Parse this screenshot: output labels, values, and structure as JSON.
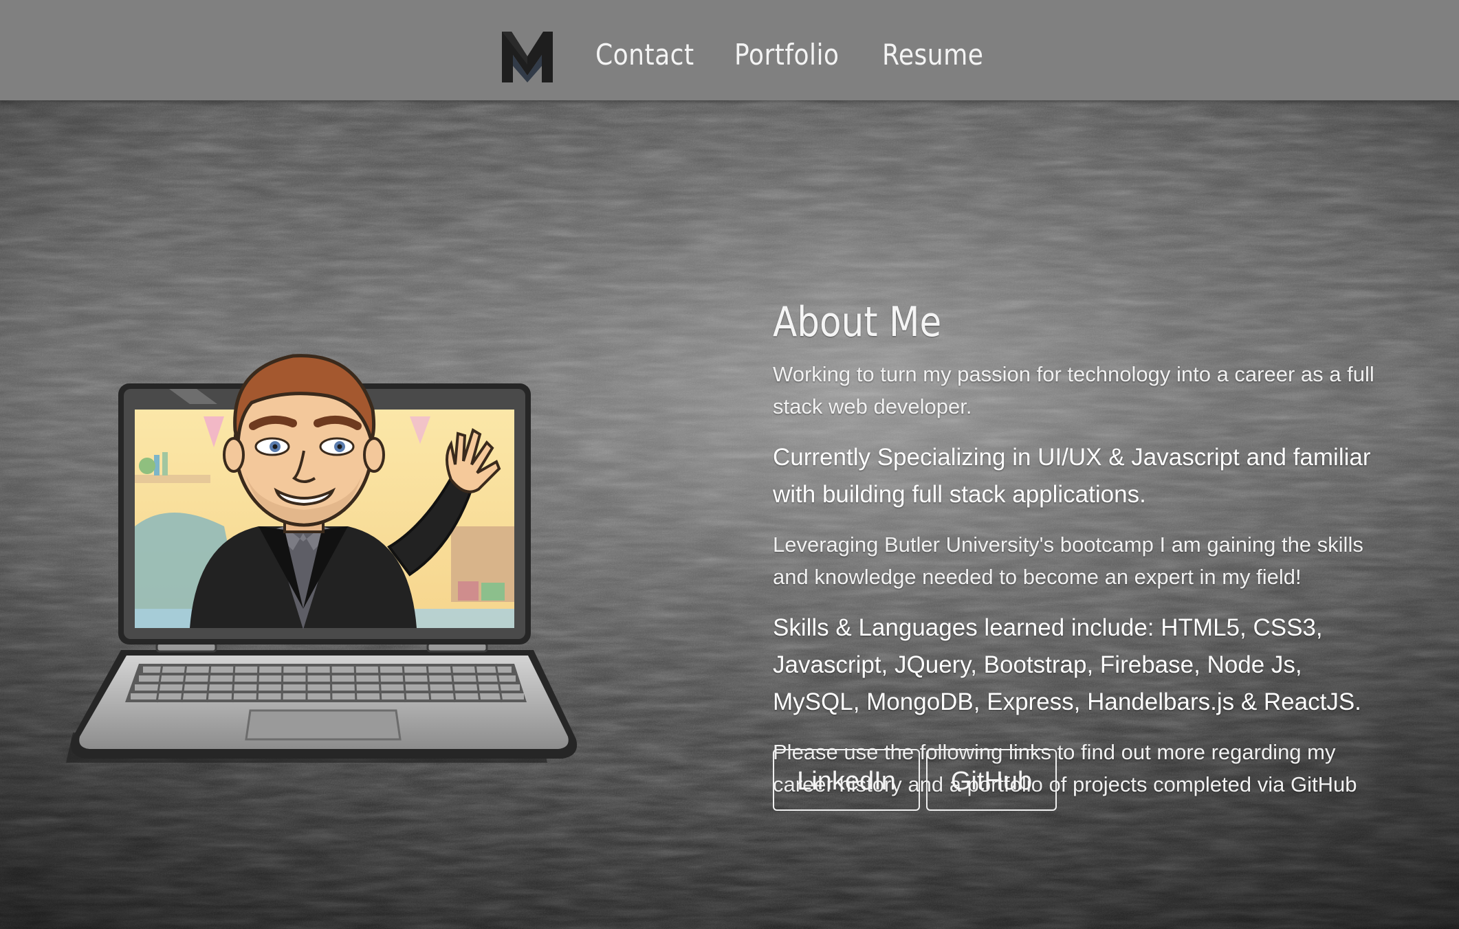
{
  "navbar": {
    "brand_icon": "m-logo-icon",
    "links": [
      {
        "label": "Contact"
      },
      {
        "label": "Portfolio"
      },
      {
        "label": "Resume"
      }
    ]
  },
  "hero": {
    "illustration": "bitmoji-laptop-waving-illustration",
    "about": {
      "title": "About Me",
      "paragraphs": [
        "Working to turn my passion for technology into a career as a full stack web developer.",
        "Currently Specializing in UI/UX & Javascript and familiar with building full stack applications.",
        "Leveraging Butler University's bootcamp I am gaining the skills and knowledge needed to become an expert in my field!",
        "Skills & Languages learned include: HTML5, CSS3, Javascript, JQuery, Bootstrap, Firebase, Node Js, MySQL, MongoDB, Express, Handelbars.js & ReactJS.",
        "Please use the following links to find out more regarding my career history and a portfolio of projects completed via GitHub"
      ],
      "buttons": [
        {
          "label": "LinkedIn"
        },
        {
          "label": "GitHub"
        }
      ]
    }
  },
  "colors": {
    "navbar_bg": "#808080",
    "nav_text": "#f4f4f4",
    "logo_dark": "#1e1e1e",
    "logo_slate": "#2f3744",
    "text": "#eeeeee"
  }
}
